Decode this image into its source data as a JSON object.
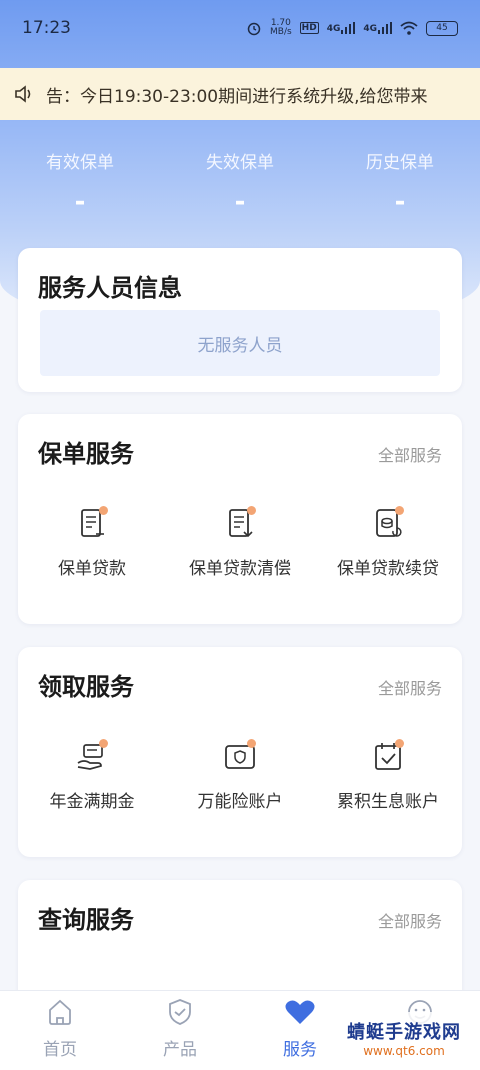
{
  "status_bar": {
    "time": "17:23",
    "net_speed": "1.70",
    "net_unit": "MB/s",
    "hd": "HD",
    "net1": "4G",
    "net2": "4G",
    "battery": "45"
  },
  "notice": {
    "text": "告：今日19:30-23:00期间进行系统升级,给您带来"
  },
  "stats": [
    {
      "label": "有效保单",
      "value": "-"
    },
    {
      "label": "失效保单",
      "value": "-"
    },
    {
      "label": "历史保单",
      "value": "-"
    }
  ],
  "staff_card": {
    "title": "服务人员信息",
    "empty_text": "无服务人员"
  },
  "policy_card": {
    "title": "保单服务",
    "more": "全部服务",
    "items": [
      {
        "label": "保单贷款",
        "icon": "loan-doc-icon"
      },
      {
        "label": "保单贷款清偿",
        "icon": "repay-doc-icon"
      },
      {
        "label": "保单贷款续贷",
        "icon": "renew-loan-icon"
      }
    ]
  },
  "claim_card": {
    "title": "领取服务",
    "more": "全部服务",
    "items": [
      {
        "label": "年金满期金",
        "icon": "annuity-icon"
      },
      {
        "label": "万能险账户",
        "icon": "wallet-icon"
      },
      {
        "label": "累积生息账户",
        "icon": "calendar-check-icon"
      }
    ]
  },
  "query_card": {
    "title": "查询服务",
    "more": "全部服务"
  },
  "tabbar": [
    {
      "label": "首页",
      "icon": "home-icon"
    },
    {
      "label": "产品",
      "icon": "shield-icon"
    },
    {
      "label": "服务",
      "icon": "heart-icon"
    },
    {
      "label": "",
      "icon": "user-icon"
    }
  ],
  "watermark": {
    "title": "蜻蜓手游戏网",
    "url": "www.qt6.com"
  },
  "colors": {
    "accent": "#3f6ee0",
    "dot": "#f3a574",
    "notice_bg": "#fbf3dc"
  }
}
